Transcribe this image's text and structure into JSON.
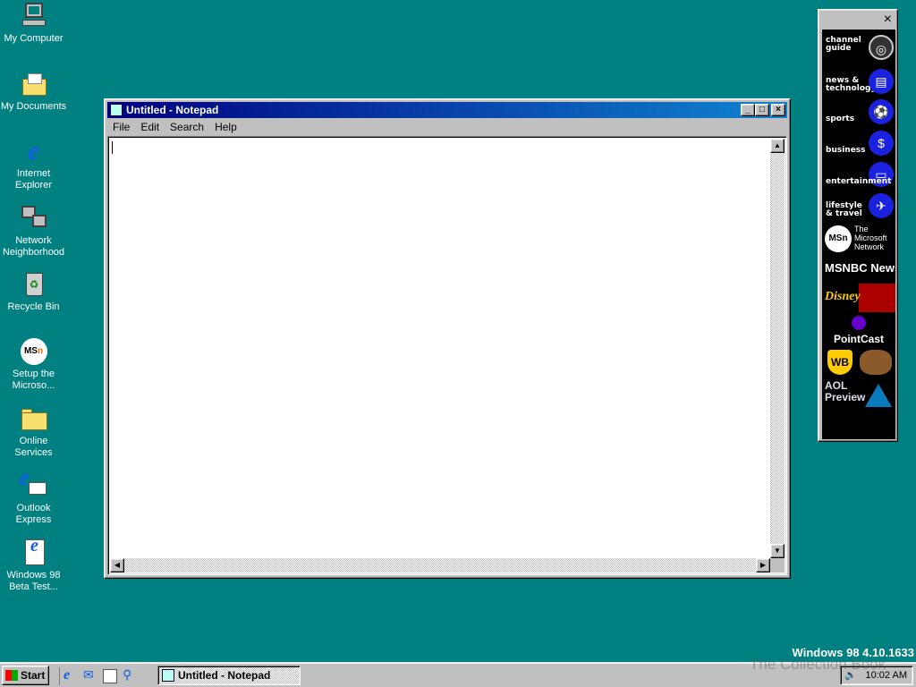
{
  "desktop": {
    "icons": [
      {
        "label": "My Computer",
        "icon": "computer-icon"
      },
      {
        "label": "My Documents",
        "icon": "folder-documents-icon"
      },
      {
        "label": "Internet Explorer",
        "icon": "internet-explorer-icon"
      },
      {
        "label": "Network Neighborhood",
        "icon": "network-icon"
      },
      {
        "label": "Recycle Bin",
        "icon": "recycle-bin-icon"
      },
      {
        "label": "Setup the Microso...",
        "icon": "msn-icon"
      },
      {
        "label": "Online Services",
        "icon": "folder-icon"
      },
      {
        "label": "Outlook Express",
        "icon": "outlook-express-icon"
      },
      {
        "label": "Windows 98 Beta Test...",
        "icon": "document-ie-icon"
      }
    ],
    "version": "Windows 98 4.10.1633",
    "watermark": "The Collection Book"
  },
  "notepad": {
    "title": "Untitled - Notepad",
    "menu": [
      "File",
      "Edit",
      "Search",
      "Help"
    ],
    "content": ""
  },
  "channel_bar": {
    "close": "×",
    "channels": [
      "channel guide",
      "news & technology",
      "sports",
      "business",
      "entertainment",
      "lifestyle & travel"
    ],
    "logos": [
      "The Microsoft Network",
      "MSNBC News",
      "Disney",
      "PointCast",
      "WB",
      "AOL Preview"
    ],
    "msn": "MSn"
  },
  "taskbar": {
    "start": "Start",
    "tasks": [
      "Untitled - Notepad"
    ],
    "clock": "10:02 AM"
  }
}
